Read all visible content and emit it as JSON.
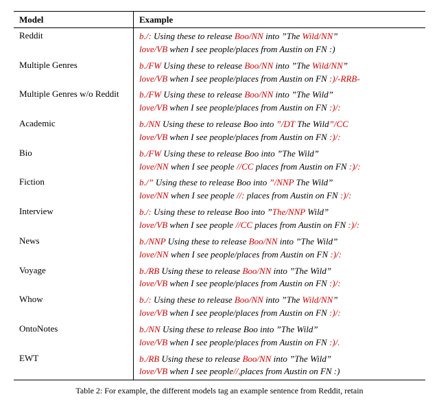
{
  "headers": {
    "model": "Model",
    "example": "Example"
  },
  "rows": [
    {
      "model": "Reddit",
      "lines": [
        [
          {
            "t": "b./:",
            "e": 1
          },
          {
            "t": " Using these to release "
          },
          {
            "t": "Boo/NN",
            "e": 1
          },
          {
            "t": " into ”The "
          },
          {
            "t": "Wild/NN",
            "e": 1
          },
          {
            "t": "”"
          }
        ],
        [
          {
            "t": "love/VB",
            "e": 1
          },
          {
            "t": " when I see people/places from Austin on FN :)"
          }
        ]
      ]
    },
    {
      "model": "Multiple Genres",
      "lines": [
        [
          {
            "t": "b./FW",
            "e": 1
          },
          {
            "t": " Using these to release "
          },
          {
            "t": "Boo/NN",
            "e": 1
          },
          {
            "t": " into ”The "
          },
          {
            "t": "Wild/NN",
            "e": 1
          },
          {
            "t": "”"
          }
        ],
        [
          {
            "t": "love/VB",
            "e": 1
          },
          {
            "t": " when I see people/places from Austin on FN "
          },
          {
            "t": ":)/-RRB-",
            "e": 1
          }
        ]
      ]
    },
    {
      "model": "Multiple Genres w/o Reddit",
      "lines": [
        [
          {
            "t": "b./FW",
            "e": 1
          },
          {
            "t": " Using these to release "
          },
          {
            "t": "Boo/NN",
            "e": 1
          },
          {
            "t": " into ”The Wild”"
          }
        ],
        [
          {
            "t": "love/VB",
            "e": 1
          },
          {
            "t": " when I see people/places from Austin on FN "
          },
          {
            "t": ":)/:",
            "e": 1
          }
        ]
      ]
    },
    {
      "model": "Academic",
      "lines": [
        [
          {
            "t": "b./NN",
            "e": 1
          },
          {
            "t": " Using these to release Boo into "
          },
          {
            "t": "”/DT",
            "e": 1
          },
          {
            "t": " The Wild"
          },
          {
            "t": "”/CC",
            "e": 1
          }
        ],
        [
          {
            "t": "love/VB",
            "e": 1
          },
          {
            "t": " when I see people/places from Austin on FN "
          },
          {
            "t": ":)/:",
            "e": 1
          }
        ]
      ]
    },
    {
      "model": "Bio",
      "lines": [
        [
          {
            "t": "b./FW",
            "e": 1
          },
          {
            "t": " Using these to release Boo into ”The Wild”"
          }
        ],
        [
          {
            "t": "love/NN",
            "e": 1
          },
          {
            "t": " when I see people "
          },
          {
            "t": "//CC",
            "e": 1
          },
          {
            "t": " places from Austin on FN "
          },
          {
            "t": ":)/:",
            "e": 1
          }
        ]
      ]
    },
    {
      "model": "Fiction",
      "lines": [
        [
          {
            "t": "b./”",
            "e": 1
          },
          {
            "t": " Using these to release Boo into "
          },
          {
            "t": "”/NNP",
            "e": 1
          },
          {
            "t": " The Wild”"
          }
        ],
        [
          {
            "t": "love/NN",
            "e": 1
          },
          {
            "t": " when I see people "
          },
          {
            "t": "//:",
            "e": 1
          },
          {
            "t": " places from Austin on FN "
          },
          {
            "t": ":)/:",
            "e": 1
          }
        ]
      ]
    },
    {
      "model": "Interview",
      "lines": [
        [
          {
            "t": "b./:",
            "e": 1
          },
          {
            "t": " Using these to release Boo into ”"
          },
          {
            "t": "The/NNP",
            "e": 1
          },
          {
            "t": " Wild”"
          }
        ],
        [
          {
            "t": "love/VB",
            "e": 1
          },
          {
            "t": " when I see people "
          },
          {
            "t": "//CC",
            "e": 1
          },
          {
            "t": " places from Austin on FN "
          },
          {
            "t": ":)/:",
            "e": 1
          }
        ]
      ]
    },
    {
      "model": "News",
      "lines": [
        [
          {
            "t": "b./NNP",
            "e": 1
          },
          {
            "t": " Using these to release "
          },
          {
            "t": "Boo/NN",
            "e": 1
          },
          {
            "t": " into ”The Wild”"
          }
        ],
        [
          {
            "t": "love/NN",
            "e": 1
          },
          {
            "t": " when I see people/places from Austin on FN "
          },
          {
            "t": ":)/:",
            "e": 1
          }
        ]
      ]
    },
    {
      "model": "Voyage",
      "lines": [
        [
          {
            "t": "b./RB",
            "e": 1
          },
          {
            "t": " Using these to release "
          },
          {
            "t": "Boo/NN",
            "e": 1
          },
          {
            "t": " into ”The Wild”"
          }
        ],
        [
          {
            "t": "love/VB",
            "e": 1
          },
          {
            "t": " when I see people/places from Austin on FN "
          },
          {
            "t": ":)/:",
            "e": 1
          }
        ]
      ]
    },
    {
      "model": "Whow",
      "lines": [
        [
          {
            "t": "b./:",
            "e": 1
          },
          {
            "t": " Using these to release "
          },
          {
            "t": "Boo/NN",
            "e": 1
          },
          {
            "t": " into ”The "
          },
          {
            "t": "Wild/NN",
            "e": 1
          },
          {
            "t": "”"
          }
        ],
        [
          {
            "t": "love/VB",
            "e": 1
          },
          {
            "t": " when I see people/places from Austin on FN "
          },
          {
            "t": ":)/:",
            "e": 1
          }
        ]
      ]
    },
    {
      "model": "OntoNotes",
      "lines": [
        [
          {
            "t": "b./NN",
            "e": 1
          },
          {
            "t": " Using these to release Boo into ”The Wild”"
          }
        ],
        [
          {
            "t": "love/VB",
            "e": 1
          },
          {
            "t": " when I see people/places from Austin on FN "
          },
          {
            "t": ":)/.",
            "e": 1
          }
        ]
      ]
    },
    {
      "model": "EWT",
      "lines": [
        [
          {
            "t": "b./RB",
            "e": 1
          },
          {
            "t": " Using these to release "
          },
          {
            "t": "Boo/NN",
            "e": 1
          },
          {
            "t": " into ”The Wild”"
          }
        ],
        [
          {
            "t": "love/VB",
            "e": 1
          },
          {
            "t": " when I see people"
          },
          {
            "t": "//,",
            "e": 1
          },
          {
            "t": "places from Austin on FN :)"
          }
        ]
      ]
    }
  ],
  "caption_prefix": "Table 2:",
  "caption_text": "For example, the different models tag an example sentence from Reddit, retain"
}
